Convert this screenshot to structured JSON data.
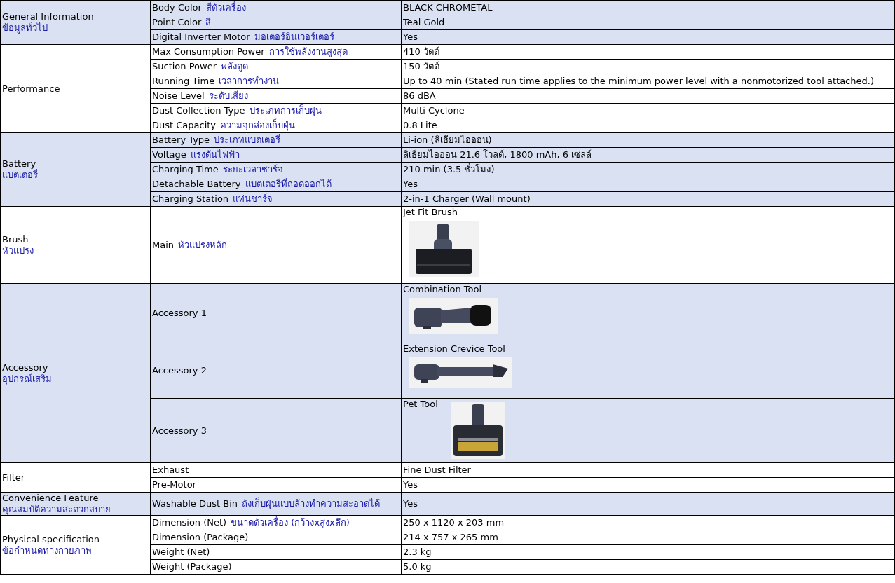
{
  "groups": [
    {
      "title": "General Information",
      "title_th": "ข้อมูลทั่วไป",
      "rows": [
        {
          "label": "Body Color",
          "label_th": "สีตัวเครื่อง",
          "value": "BLACK CHROMETAL"
        },
        {
          "label": "Point Color",
          "label_th": "สี",
          "value": "Teal Gold"
        },
        {
          "label": "Digital Inverter Motor",
          "label_th": "มอเตอร์อินเวอร์เตอร์",
          "value": "Yes"
        }
      ]
    },
    {
      "title": "Performance",
      "rows": [
        {
          "label": "Max Consumption Power",
          "label_th": "การใช้พลังงานสูงสุด",
          "value": "410 วัตต์"
        },
        {
          "label": "Suction Power",
          "label_th": "พลังดูด",
          "value": "150 วัตต์"
        },
        {
          "label": "Running Time",
          "label_th": "เวลาการทำงาน",
          "value": "Up to 40 min (Stated run time applies to the minimum power level with a nonmotorized tool attached.)"
        },
        {
          "label": "Noise Level",
          "label_th": "ระดับเสียง",
          "value": "86 dBA"
        },
        {
          "label": "Dust Collection Type",
          "label_th": "ประเภทการเก็บฝุ่น",
          "value": "Multi Cyclone"
        },
        {
          "label": "Dust Capacity",
          "label_th": "ความจุกล่องเก็บฝุ่น",
          "value": "0.8 Lite"
        }
      ]
    },
    {
      "title": "Battery",
      "title_th": "แบตเตอรี่",
      "rows": [
        {
          "label": "Battery Type",
          "label_th": "ประเภทแบตเตอรี่",
          "value": "Li-ion (ลิเธียมไอออน)"
        },
        {
          "label": "Voltage",
          "label_th": "แรงดันไฟฟ้า",
          "value": "ลิเธียมไอออน 21.6 โวลต์, 1800 mAh, 6 เซลล์"
        },
        {
          "label": "Charging Time",
          "label_th": "ระยะเวลาชาร์จ",
          "value": "210 min (3.5 ชั่วโมง)"
        },
        {
          "label": "Detachable Battery",
          "label_th": "แบตเตอรี่ที่ถอดออกได้",
          "value": "Yes"
        },
        {
          "label": "Charging Station",
          "label_th": "แท่นชาร์จ",
          "value": "2-in-1 Charger (Wall mount)"
        }
      ]
    },
    {
      "title": "Brush",
      "title_th": "หัวแปรง",
      "rows": [
        {
          "label": "Main",
          "label_th": "หัวแปรงหลัก",
          "value": "Jet Fit Brush"
        }
      ]
    },
    {
      "title": "Accessory",
      "title_th": "อุปกรณ์เสริม",
      "rows": [
        {
          "label": "Accessory 1",
          "value": "Combination Tool"
        },
        {
          "label": "Accessory 2",
          "value": "Extension Crevice Tool"
        },
        {
          "label": "Accessory 3",
          "value": "Pet Tool"
        }
      ]
    },
    {
      "title": "Filter",
      "rows": [
        {
          "label": "Exhaust",
          "value": "Fine Dust Filter"
        },
        {
          "label": "Pre-Motor",
          "value": "Yes"
        }
      ]
    },
    {
      "title": "Convenience Feature",
      "title_th": "คุณสมบัติความสะดวกสบาย",
      "rows": [
        {
          "label": "Washable Dust Bin",
          "label_th": "ถังเก็บฝุ่นแบบล้างทำความสะอาดได้",
          "value": "Yes"
        }
      ]
    },
    {
      "title": "Physical specification",
      "title_th": "ข้อกำหนดทางกายภาพ",
      "rows": [
        {
          "label": "Dimension (Net)",
          "label_th": "ขนาดตัวเครื่อง (กว้างxสูงxลึก)",
          "value": "250 x 1120 x 203 mm"
        },
        {
          "label": "Dimension (Package)",
          "value": "214 x 757 x 265 mm"
        },
        {
          "label": "Weight (Net)",
          "value": "2.3 kg"
        },
        {
          "label": "Weight (Package)",
          "value": "5.0 kg"
        }
      ]
    }
  ]
}
